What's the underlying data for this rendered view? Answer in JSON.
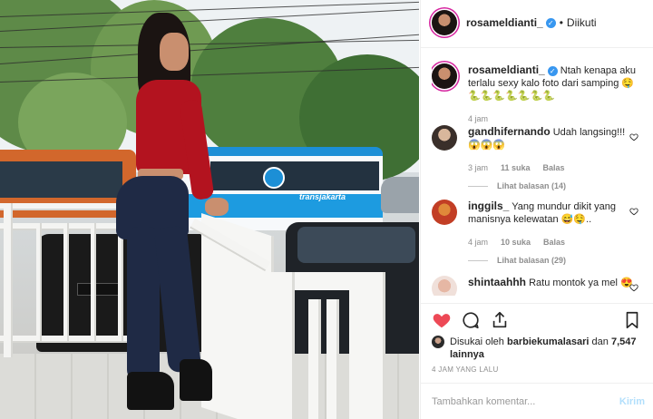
{
  "post_author": {
    "username": "rosameldianti_",
    "verified_icon": "verified-badge-icon",
    "follow_status": "Diikuti"
  },
  "caption": {
    "username": "rosameldianti_",
    "text": "Ntah kenapa aku terlalu sexy kalo foto dari samping",
    "emojis": "🤤🐍🐍🐍🐍🐍🐍🐍",
    "time": "4 jam"
  },
  "comments": [
    {
      "username": "gandhifernando",
      "text": "Udah langsing!!!",
      "emojis": "😱😱😱",
      "time": "3 jam",
      "likes": "11 suka",
      "reply_label": "Balas",
      "view_replies": "Lihat balasan (14)"
    },
    {
      "username": "inggils_",
      "text": "Yang mundur dikit yang manisnya kelewatan",
      "emojis": "😅🤤..",
      "time": "4 jam",
      "likes": "10 suka",
      "reply_label": "Balas",
      "view_replies": "Lihat balasan (29)"
    },
    {
      "username": "shintaahhh",
      "text": "Ratu montok ya mel",
      "emojis": "😍",
      "time": "",
      "likes": "",
      "reply_label": "",
      "view_replies": ""
    }
  ],
  "likes_summary": {
    "prefix": "Disukai oleh",
    "liker": "barbiekumalasari",
    "joiner": "dan",
    "others": "7,547 lainnya"
  },
  "timestamp": "4 JAM YANG LALU",
  "composer": {
    "placeholder": "Tambahkan komentar...",
    "post_label": "Kirim"
  },
  "colors": {
    "like_red": "#ed4956",
    "verified_blue": "#3897f0",
    "post_button": "#b2dffc"
  },
  "photo_bus_text": "transjakarta"
}
